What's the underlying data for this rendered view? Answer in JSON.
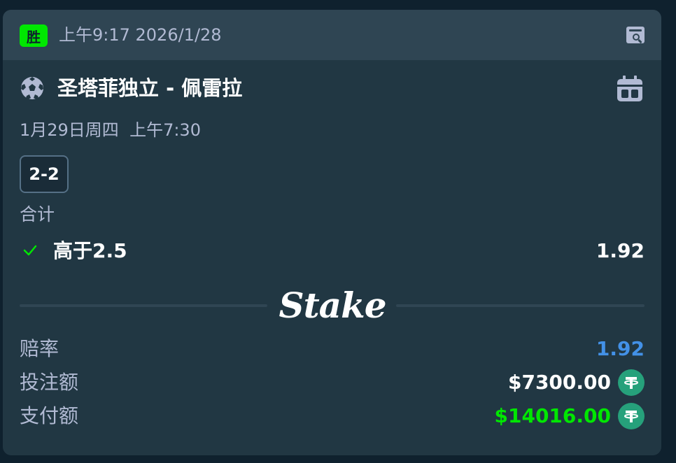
{
  "header": {
    "badge": "胜",
    "timestamp": "上午9:17 2026/1/28",
    "bet_icon": "receipt-search-icon"
  },
  "event": {
    "sport_icon": "soccer-ball-icon",
    "title": "圣塔菲独立 - 佩雷拉",
    "calendar_icon": "calendar-icon",
    "date": "1月29日周四  上午7:30",
    "score": "2-2"
  },
  "market": {
    "label": "合计",
    "selection": "高于2.5",
    "odds": "1.92",
    "status_icon": "check-icon"
  },
  "brand": {
    "logo": "Stake"
  },
  "summary": {
    "odds_label": "赔率",
    "odds_value": "1.92",
    "stake_label": "投注额",
    "stake_value": "$7300.00",
    "payout_label": "支付额",
    "payout_value": "$14016.00",
    "currency_icon": "usdt-icon"
  },
  "colors": {
    "win": "#00e701",
    "odds": "#4391e7",
    "text_secondary": "#b1bad3",
    "card": "#213743",
    "header": "#2f4553"
  }
}
